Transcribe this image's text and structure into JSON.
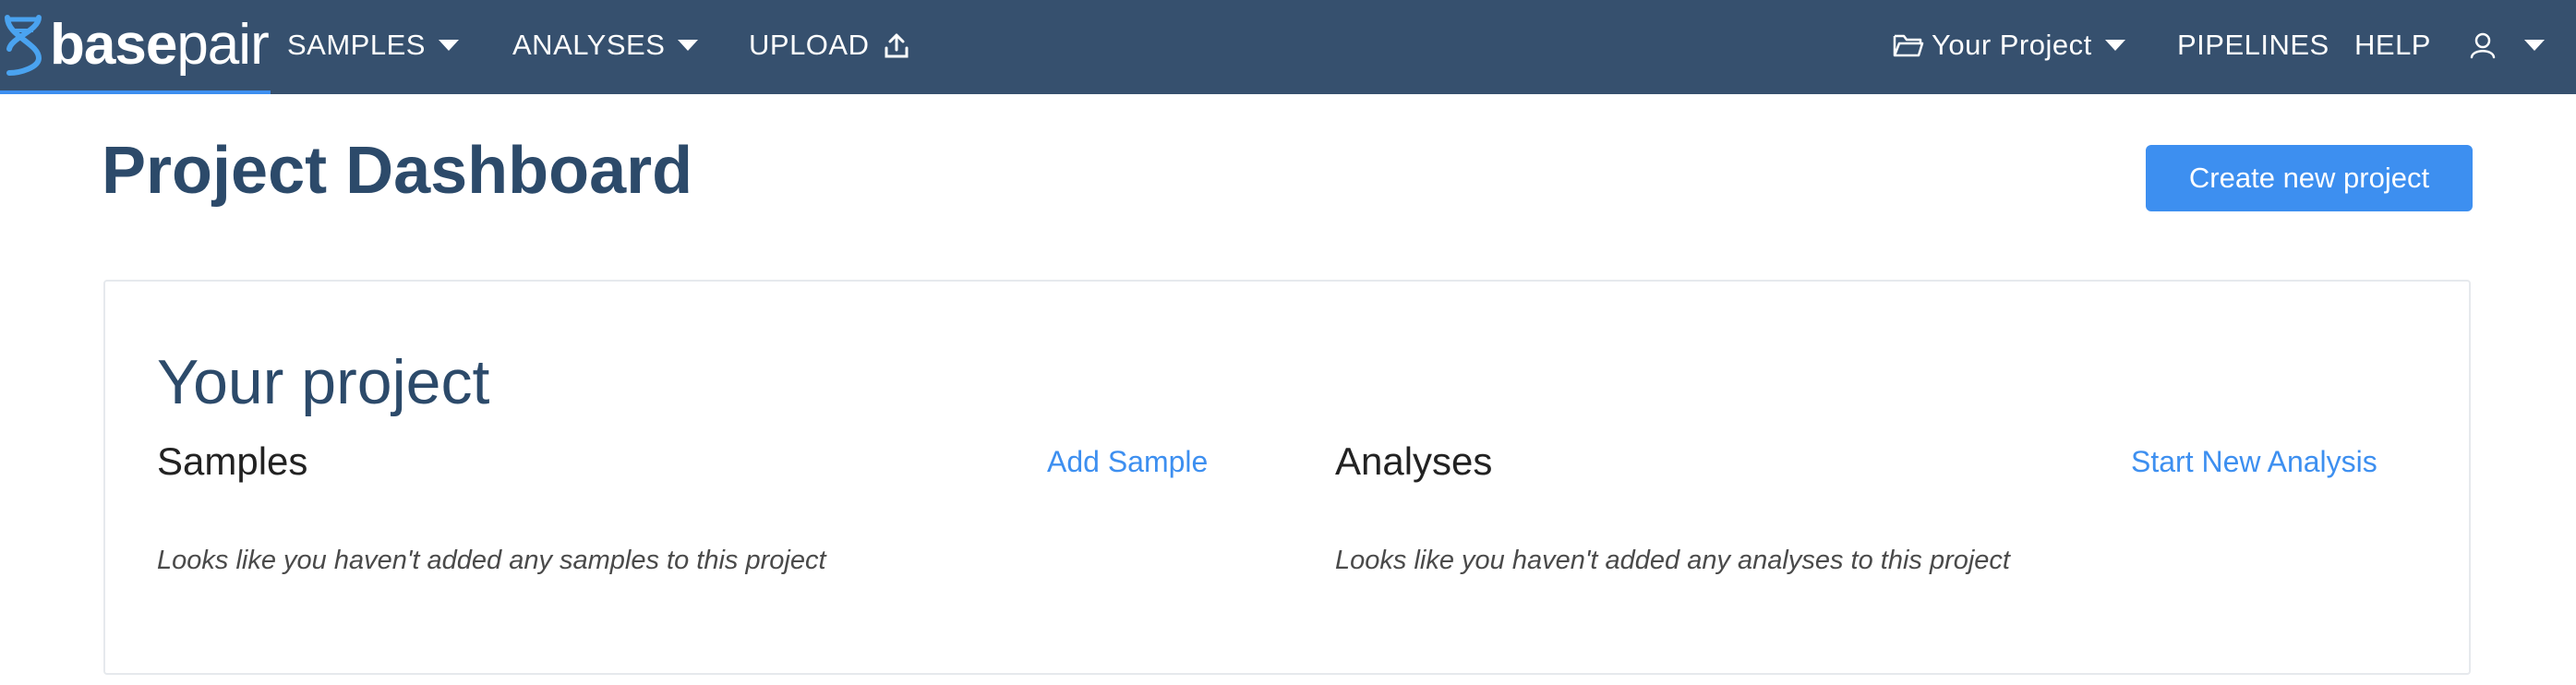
{
  "nav": {
    "brand_bold": "base",
    "brand_light": "pair",
    "samples": "SAMPLES",
    "analyses": "ANALYSES",
    "upload": "UPLOAD",
    "project": "Your Project",
    "pipelines": "PIPELINES",
    "help": "HELP"
  },
  "page": {
    "title": "Project Dashboard",
    "create_button": "Create new project"
  },
  "project": {
    "title": "Your project",
    "samples": {
      "heading": "Samples",
      "action": "Add Sample",
      "empty": "Looks like you haven't added any samples to this project"
    },
    "analyses": {
      "heading": "Analyses",
      "action": "Start New Analysis",
      "empty": "Looks like you haven't added any analyses to this project"
    }
  },
  "colors": {
    "navbar": "#36506e",
    "accent": "#3d8ff0",
    "heading": "#2c4a6a"
  },
  "icons": [
    "dna-logo-icon",
    "upload-icon",
    "folder-icon",
    "user-icon",
    "caret-down-icon"
  ]
}
